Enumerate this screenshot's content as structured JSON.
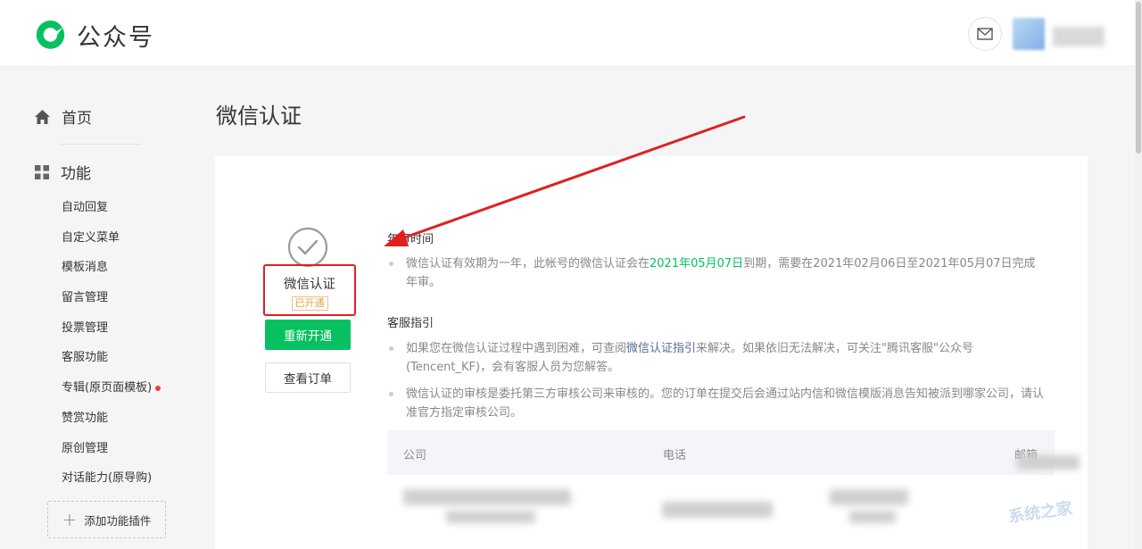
{
  "header": {
    "logo_text": "公众号"
  },
  "sidebar": {
    "home_label": "首页",
    "function_label": "功能",
    "items": [
      {
        "label": "自动回复"
      },
      {
        "label": "自定义菜单"
      },
      {
        "label": "模板消息"
      },
      {
        "label": "留言管理"
      },
      {
        "label": "投票管理"
      },
      {
        "label": "客服功能"
      },
      {
        "label": "专辑(原页面模板)",
        "has_dot": true
      },
      {
        "label": "赞赏功能"
      },
      {
        "label": "原创管理"
      },
      {
        "label": "对话能力(原导购)"
      }
    ],
    "add_plugin_label": "添加功能插件"
  },
  "main": {
    "page_title": "微信认证",
    "cert": {
      "name": "微信认证",
      "status": "已开通",
      "renew_button": "重新开通",
      "order_button": "查看订单"
    },
    "annual": {
      "title": "年审时间",
      "text_before": "微信认证有效期为一年，此帐号的微信认证会在",
      "expire_date": "2021年05月07日",
      "text_after": "到期，需要在2021年02月06日至2021年05月07日完成年审。"
    },
    "service": {
      "title": "客服指引",
      "bullet1_before": "如果您在微信认证过程中遇到困难，可查阅",
      "bullet1_link": "微信认证指引",
      "bullet1_after": "来解决。如果依旧无法解决，可关注\"腾讯客服\"公众号(Tencent_KF)，会有客服人员为您解答。",
      "bullet2": "微信认证的审核是委托第三方审核公司来审核的。您的订单在提交后会通过站内信和微信模版消息告知被派到哪家公司，请认准官方指定审核公司。"
    },
    "table": {
      "headers": [
        "公司",
        "电话",
        "邮箱"
      ]
    }
  },
  "watermark": "系统之家",
  "colors": {
    "brand_green": "#07c160",
    "highlight_red": "#e02020",
    "link_blue": "#576b95"
  }
}
